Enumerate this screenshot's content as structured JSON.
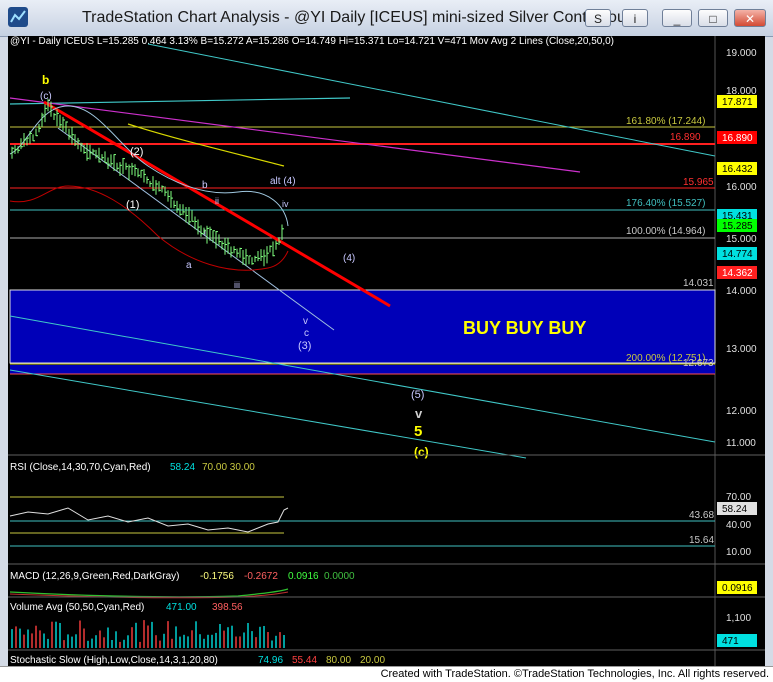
{
  "window": {
    "title": "TradeStation Chart Analysis - @YI Daily [ICEUS] mini-sized Silver Continuous",
    "buttons": {
      "s": "S",
      "i": "i",
      "minimize": "_",
      "maximize": "□",
      "close": "✕"
    }
  },
  "footer": "Created with TradeStation. ©TradeStation Technologies, Inc. All rights reserved.",
  "colors": {
    "background": "#000000",
    "price_bar": "#7fff7f",
    "trendline": "#ff0000",
    "buy_zone": "#0000cc",
    "fib": "#c8c840",
    "wave_label": "#ffff00",
    "cyan": "#00e0e0"
  },
  "price_panel": {
    "header": "@YI - Daily  ICEUS  L=15.285  0.464  3.13%  B=15.272  A=15.286  O=14.749  Hi=15.371  Lo=14.721  V=471  Mov Avg 2 Lines (Close,20,50,0)",
    "axis_ticks": [
      "19.000",
      "18.000",
      "17.000",
      "16.000",
      "15.000",
      "14.000",
      "13.000",
      "12.000",
      "11.000"
    ],
    "price_tags": [
      {
        "text": "17.871",
        "bg": "#ffff00",
        "fg": "#000000"
      },
      {
        "text": "16.890",
        "bg": "#ff0000",
        "fg": "#ffffff"
      },
      {
        "text": "16.432",
        "bg": "#ffff00",
        "fg": "#000000"
      },
      {
        "text": "15.431",
        "bg": "#00e0e0",
        "fg": "#000000"
      },
      {
        "text": "15.285",
        "bg": "#00ff00",
        "fg": "#000000"
      },
      {
        "text": "14.774",
        "bg": "#00e0e0",
        "fg": "#000000"
      },
      {
        "text": "14.362",
        "bg": "#ff2020",
        "fg": "#ffffff"
      }
    ],
    "fib_labels": [
      {
        "text": "161.80% (17.244)",
        "color": "#c8c840"
      },
      {
        "text": "16.890",
        "color": "#ff3030"
      },
      {
        "text": "15.965",
        "color": "#ff3030"
      },
      {
        "text": "176.40% (15.527)",
        "color": "#40c0c0"
      },
      {
        "text": "100.00% (14.964)",
        "color": "#c8c8c8"
      },
      {
        "text": "14.031",
        "color": "#c8c8c8"
      },
      {
        "text": "200.00% (12.751)",
        "color": "#c8c840"
      },
      {
        "text": "12.673",
        "color": "#c8c8c8"
      }
    ],
    "buy_text": "BUY BUY BUY",
    "wave_labels": {
      "b_top": "b",
      "c_top": "(c)",
      "two": "(2)",
      "one": "(1)",
      "b_small": "b",
      "ii": "ii",
      "i": "i",
      "a": "a",
      "iii": "iii",
      "alt4": "alt (4)",
      "iv": "iv",
      "four": "(4)",
      "v": "v",
      "c": "c",
      "three": "(3)",
      "five_p": "(5)",
      "v_big": "v",
      "five": "5",
      "c_bottom": "(c)"
    }
  },
  "rsi_panel": {
    "header_name": "RSI (Close,14,30,70,Cyan,Red)",
    "header_value": "58.24",
    "header_levels": "70.00  30.00",
    "axis_ticks": [
      "70.00",
      "40.00",
      "10.00"
    ],
    "value_tag": "58.24",
    "levels": [
      "43.68",
      "15.64"
    ]
  },
  "macd_panel": {
    "header_name": "MACD (12,26,9,Green,Red,DarkGray)",
    "macd": "-0.1756",
    "signal": "-0.2672",
    "diff": "0.0916",
    "zero": "0.0000",
    "value_tag": "0.0916"
  },
  "volume_panel": {
    "header_name": "Volume Avg (50,50,Cyan,Red)",
    "volume": "471.00",
    "avg": "398.56",
    "axis_ticks": [
      "1,100"
    ],
    "value_tag": "471"
  },
  "stoch_panel": {
    "header_name": "Stochastic Slow (High,Low,Close,14,3,1,20,80)",
    "k": "74.96",
    "d": "55.44",
    "high": "80.00",
    "low": "20.00"
  }
}
